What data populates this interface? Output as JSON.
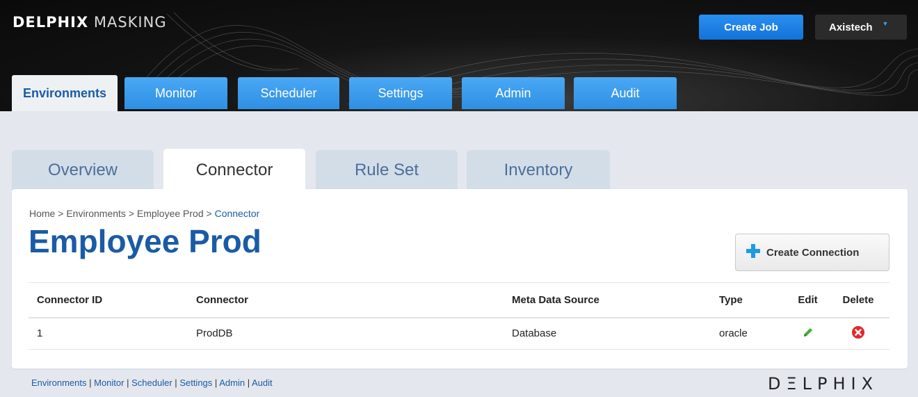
{
  "header": {
    "brand_bold": "DELPHIX",
    "brand_light": "MASKING",
    "create_job_label": "Create Job",
    "user_name": "Axistech",
    "user_caret": "▼"
  },
  "main_tabs": [
    {
      "label": "Environments",
      "active": true
    },
    {
      "label": "Monitor",
      "active": false
    },
    {
      "label": "Scheduler",
      "active": false
    },
    {
      "label": "Settings",
      "active": false
    },
    {
      "label": "Admin",
      "active": false
    },
    {
      "label": "Audit",
      "active": false
    }
  ],
  "sub_tabs": [
    {
      "label": "Overview",
      "active": false
    },
    {
      "label": "Connector",
      "active": true
    },
    {
      "label": "Rule Set",
      "active": false
    },
    {
      "label": "Inventory",
      "active": false
    }
  ],
  "breadcrumb": {
    "home": "Home",
    "sep": ">",
    "environments": "Environments",
    "env": "Employee Prod",
    "current": "Connector"
  },
  "page_title": "Employee Prod",
  "create_connection_label": "Create Connection",
  "table": {
    "headers": {
      "id": "Connector ID",
      "connector": "Connector",
      "meta": "Meta Data Source",
      "type": "Type",
      "edit": "Edit",
      "delete": "Delete"
    },
    "rows": [
      {
        "id": "1",
        "connector": "ProdDB",
        "meta": "Database",
        "type": "oracle"
      }
    ]
  },
  "footer": {
    "links": [
      "Environments",
      "Monitor",
      "Scheduler",
      "Settings",
      "Admin",
      "Audit"
    ],
    "separator": "|",
    "logo_text": "DΞLPHIX"
  },
  "colors": {
    "accent_blue": "#1a5ba6",
    "button_blue": "#2a8ff0",
    "edit_green": "#3cb034",
    "delete_red": "#e3272b"
  },
  "icons": {
    "create_connection": "plus-icon",
    "edit": "pencil-icon",
    "delete": "x-circle-icon",
    "user_menu": "caret-down-icon"
  }
}
